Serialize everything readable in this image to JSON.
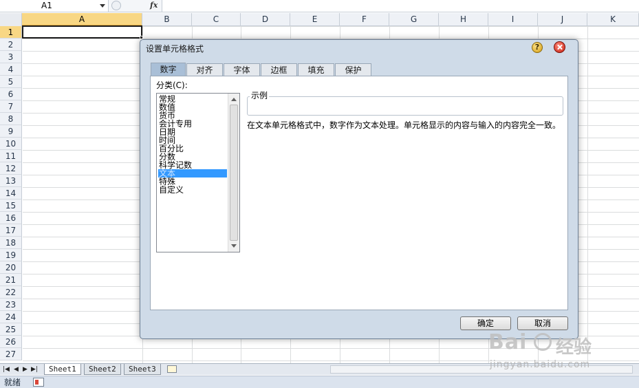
{
  "formula_bar": {
    "name_box_value": "A1",
    "fx_label": "fx"
  },
  "columns": [
    "A",
    "B",
    "C",
    "D",
    "E",
    "F",
    "G",
    "H",
    "I",
    "J",
    "K"
  ],
  "rows": [
    "1",
    "2",
    "3",
    "4",
    "5",
    "6",
    "7",
    "8",
    "9",
    "10",
    "11",
    "12",
    "13",
    "14",
    "15",
    "16",
    "17",
    "18",
    "19",
    "20",
    "21",
    "22",
    "23",
    "24",
    "25",
    "26",
    "27"
  ],
  "active_cell": "A1",
  "sheet_tabs": [
    "Sheet1",
    "Sheet2",
    "Sheet3"
  ],
  "active_sheet": "Sheet1",
  "status": {
    "ready_text": "就绪"
  },
  "dialog": {
    "title": "设置单元格格式",
    "help_label": "?",
    "tabs": [
      "数字",
      "对齐",
      "字体",
      "边框",
      "填充",
      "保护"
    ],
    "active_tab": "数字",
    "category_label": "分类(C):",
    "categories": [
      "常规",
      "数值",
      "货币",
      "会计专用",
      "日期",
      "时间",
      "百分比",
      "分数",
      "科学记数",
      "文本",
      "特殊",
      "自定义"
    ],
    "selected_category": "文本",
    "sample_label": "示例",
    "description": "在文本单元格格式中，数字作为文本处理。单元格显示的内容与输入的内容完全一致。",
    "ok_label": "确定",
    "cancel_label": "取消"
  },
  "watermark": {
    "logo": "Bai",
    "logo_cn": "经验",
    "url": "jingyan.baidu.com"
  },
  "colors": {
    "selection_blue": "#3399ff",
    "header_active": "#f8d784",
    "dialog_frame": "#cfdbe8"
  }
}
